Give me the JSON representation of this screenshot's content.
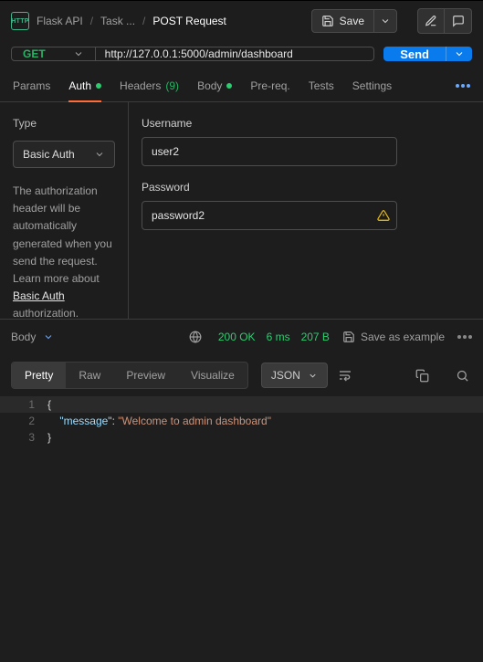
{
  "breadcrumbs": {
    "item1": "Flask API",
    "item2": "Task ...",
    "item3": "POST Request"
  },
  "toolbar": {
    "save": "Save"
  },
  "request": {
    "method": "GET",
    "url": "http://127.0.0.1:5000/admin/dashboard",
    "send": "Send"
  },
  "tabs": {
    "params": "Params",
    "auth": "Auth",
    "headers": "Headers",
    "headers_count": "(9)",
    "body": "Body",
    "prereq": "Pre-req.",
    "tests": "Tests",
    "settings": "Settings"
  },
  "auth": {
    "type_label": "Type",
    "type_value": "Basic Auth",
    "help_pre": "The authorization header will be automatically generated when you send the request. Learn more about ",
    "help_link": "Basic Auth",
    "help_post": " authorization.",
    "username_label": "Username",
    "username": "user2",
    "password_label": "Password",
    "password": "password2"
  },
  "response": {
    "body_label": "Body",
    "status": "200 OK",
    "time": "6 ms",
    "size": "207 B",
    "save_example": "Save as example",
    "views": {
      "pretty": "Pretty",
      "raw": "Raw",
      "preview": "Preview",
      "visualize": "Visualize"
    },
    "format": "JSON",
    "code": {
      "l1": "{",
      "l2_key": "\"message\"",
      "l2_val": "\"Welcome to admin dashboard\"",
      "l3": "}"
    }
  }
}
